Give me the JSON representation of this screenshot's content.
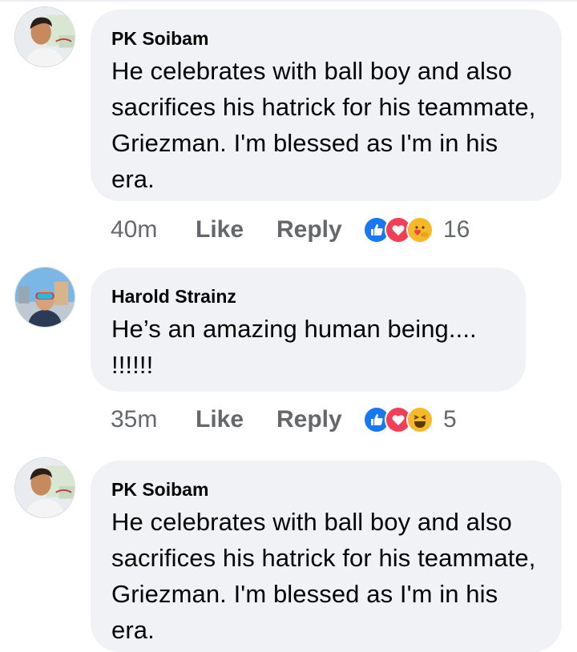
{
  "comments": [
    {
      "author": "PK Soibam",
      "text": "He celebrates with ball boy and also sacrifices his hatrick for his teammate, Griezman. I'm blessed as I'm in his era.",
      "time": "40m",
      "like_label": "Like",
      "reply_label": "Reply",
      "reactions": [
        "like-icon",
        "love-icon",
        "care-icon"
      ],
      "reaction_count": "16"
    },
    {
      "author": "Harold Strainz",
      "text": "He’s an amazing human being.... !!!!!!",
      "time": "35m",
      "like_label": "Like",
      "reply_label": "Reply",
      "reactions": [
        "like-icon",
        "love-icon",
        "haha-icon"
      ],
      "reaction_count": "5"
    },
    {
      "author": "PK Soibam",
      "text": "He celebrates with ball boy and also sacrifices his hatrick for his teammate, Griezman. I'm blessed as I'm in his era."
    }
  ],
  "colors": {
    "bubble": "#f0f2f5",
    "meta_text": "#65676b",
    "like_blue": "#1877f2",
    "love_red": "#f33e58",
    "emoji_yellow": "#f7b928"
  }
}
